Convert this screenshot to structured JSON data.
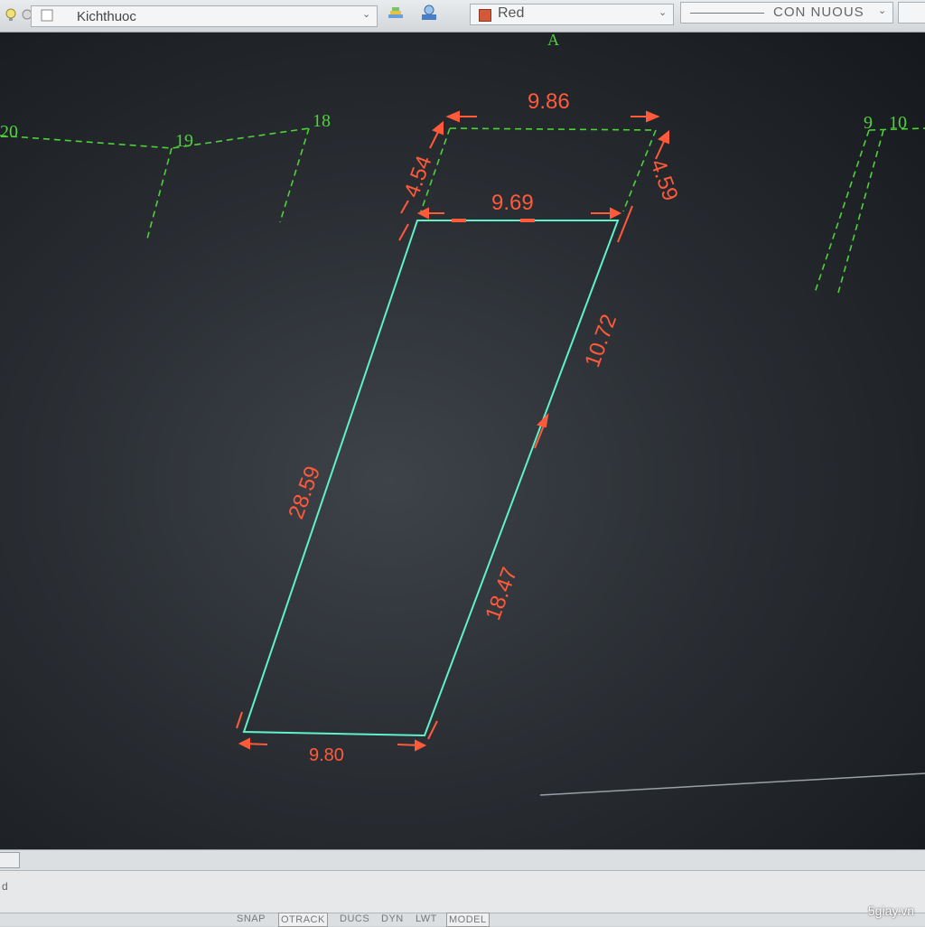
{
  "toolbar": {
    "layer_name": "Kichthuoc",
    "color_name": "Red",
    "color_hex": "#d4583a",
    "linetype_name": "CON  NUOUS",
    "icons": [
      "lightbulb-icon",
      "sun-icon",
      "layer-freeze-box-icon",
      "layer-states-icon",
      "layer-properties-icon"
    ]
  },
  "drawing": {
    "top_marker": "A",
    "parcel_labels": [
      "20",
      "19",
      "18",
      "9",
      "10"
    ],
    "dimensions": {
      "top_outer": "9.86",
      "top_inner": "9.69",
      "left_short": "4.54",
      "right_short": "4.59",
      "right_upper": "10.72",
      "left_long": "28.59",
      "right_lower": "18.47",
      "bottom": "9.80"
    },
    "colors": {
      "boundary": "#5ff2c8",
      "parcel_dash": "#4ed13a",
      "dimension": "#ff5a3a",
      "background": "#2a2e33"
    }
  },
  "statusbar": {
    "items": [
      "SNAP",
      "OTRACK",
      "DUCS",
      "DYN",
      "LWT",
      "MODEL"
    ],
    "active": [
      "OTRACK",
      "MODEL"
    ]
  },
  "command": {
    "prompt": "d"
  },
  "watermark": "5giay.vn"
}
